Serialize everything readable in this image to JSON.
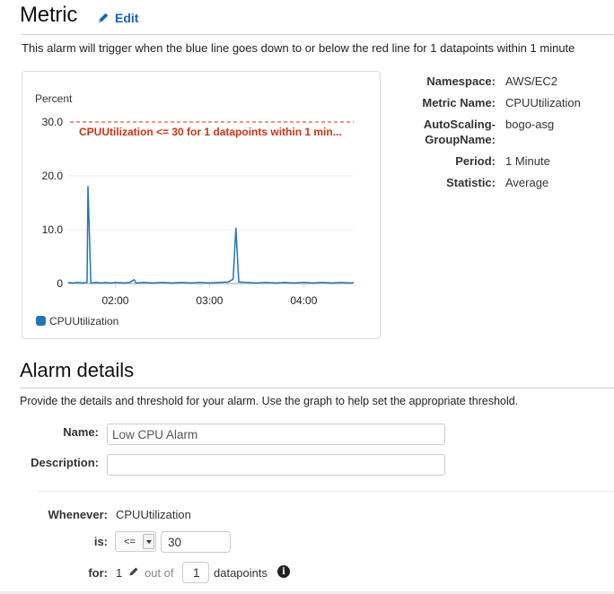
{
  "metric": {
    "title": "Metric",
    "edit_label": "Edit",
    "edit_icon": "pencil-icon",
    "description": "This alarm will trigger when the blue line goes down to or below the red line for 1 datapoints within 1 minute"
  },
  "metric_properties": [
    {
      "label": "Namespace:",
      "value": "AWS/EC2"
    },
    {
      "label": "Metric Name:",
      "value": "CPUUtilization"
    },
    {
      "label": "AutoScaling-GroupName:",
      "label_lines": [
        "AutoScaling-",
        "GroupName:"
      ],
      "value": "bogo-asg"
    },
    {
      "label": "Period:",
      "value": "1 Minute"
    },
    {
      "label": "Statistic:",
      "value": "Average"
    }
  ],
  "chart_data": {
    "type": "line",
    "title": "",
    "ylabel": "Percent",
    "xlabel": "",
    "ylim": [
      0,
      30
    ],
    "yticks": [
      0,
      10,
      20,
      30
    ],
    "ytick_labels": [
      "0",
      "10.0",
      "20.0",
      "30.0"
    ],
    "xlim_hours": [
      1.5,
      4.53
    ],
    "xticks_hours": [
      2,
      3,
      4
    ],
    "xtick_labels": [
      "02:00",
      "03:00",
      "04:00"
    ],
    "grid": true,
    "legend_position": "bottom-left",
    "threshold": {
      "value": 30,
      "label": "CPUUtilization <= 30 for 1 datapoints within 1 min...",
      "color": "#d13212"
    },
    "series": [
      {
        "name": "CPUUtilization",
        "color": "#1f77b4",
        "points": [
          [
            1.5,
            0.2
          ],
          [
            1.55,
            0.1
          ],
          [
            1.6,
            0.2
          ],
          [
            1.65,
            0.1
          ],
          [
            1.7,
            0.2
          ],
          [
            1.71,
            18.0
          ],
          [
            1.74,
            0.1
          ],
          [
            1.8,
            0.2
          ],
          [
            1.85,
            0.1
          ],
          [
            1.9,
            0.2
          ],
          [
            1.95,
            0.1
          ],
          [
            2.0,
            0.2
          ],
          [
            2.1,
            0.1
          ],
          [
            2.15,
            0.2
          ],
          [
            2.2,
            0.7
          ],
          [
            2.22,
            0.1
          ],
          [
            2.3,
            0.2
          ],
          [
            2.4,
            0.1
          ],
          [
            2.5,
            0.2
          ],
          [
            2.6,
            0.1
          ],
          [
            2.7,
            0.2
          ],
          [
            2.8,
            0.1
          ],
          [
            2.9,
            0.2
          ],
          [
            3.0,
            0.1
          ],
          [
            3.1,
            0.2
          ],
          [
            3.2,
            0.3
          ],
          [
            3.25,
            0.8
          ],
          [
            3.28,
            10.3
          ],
          [
            3.31,
            0.3
          ],
          [
            3.4,
            0.2
          ],
          [
            3.5,
            0.1
          ],
          [
            3.6,
            0.2
          ],
          [
            3.7,
            0.1
          ],
          [
            3.8,
            0.2
          ],
          [
            3.9,
            0.1
          ],
          [
            4.0,
            0.2
          ],
          [
            4.1,
            0.1
          ],
          [
            4.2,
            0.2
          ],
          [
            4.3,
            0.1
          ],
          [
            4.4,
            0.2
          ],
          [
            4.5,
            0.1
          ],
          [
            4.53,
            0.2
          ]
        ]
      }
    ]
  },
  "alarm_details": {
    "title": "Alarm details",
    "description": "Provide the details and threshold for your alarm. Use the graph to help set the appropriate threshold.",
    "name_label": "Name:",
    "name_value": "Low CPU Alarm",
    "description_label": "Description:",
    "description_value": "",
    "whenever_label": "Whenever:",
    "whenever_value": "CPUUtilization",
    "is_label": "is:",
    "operator_value": "<=",
    "threshold_value": "30",
    "for_label": "for:",
    "for_datapoints": "1",
    "out_of_label": "out of",
    "evaluation_periods": "1",
    "datapoints_label": "datapoints",
    "info_icon": "i"
  },
  "colors": {
    "link": "#1166bb",
    "threshold": "#d13212",
    "series": "#1f77b4"
  }
}
